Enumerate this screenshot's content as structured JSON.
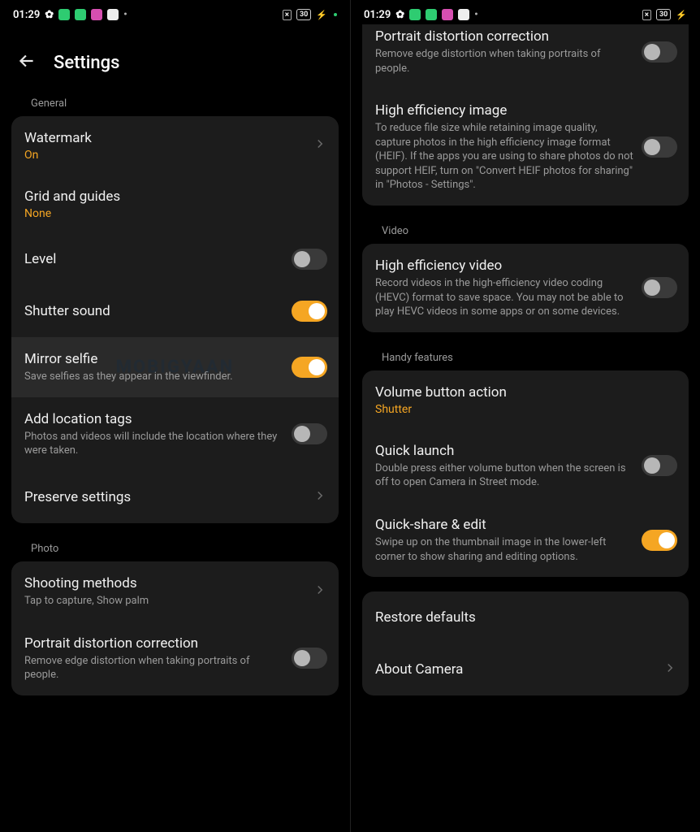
{
  "statusbar": {
    "time": "01:29",
    "battery": "30"
  },
  "header": {
    "title": "Settings"
  },
  "left": {
    "section_general": "General",
    "watermark": {
      "title": "Watermark",
      "value": "On"
    },
    "grid": {
      "title": "Grid and guides",
      "value": "None"
    },
    "level": {
      "title": "Level"
    },
    "shutter": {
      "title": "Shutter sound"
    },
    "mirror": {
      "title": "Mirror selfie",
      "sub": "Save selfies as they appear in the viewfinder."
    },
    "location": {
      "title": "Add location tags",
      "sub": "Photos and videos will include the location where they were taken."
    },
    "preserve": {
      "title": "Preserve settings"
    },
    "section_photo": "Photo",
    "shooting": {
      "title": "Shooting methods",
      "sub": "Tap to capture, Show palm"
    },
    "portrait": {
      "title": "Portrait distortion correction",
      "sub": "Remove edge distortion when taking portraits of people."
    }
  },
  "right": {
    "portrait": {
      "title": "Portrait distortion correction",
      "sub": "Remove edge distortion when taking portraits of people."
    },
    "heif": {
      "title": "High efficiency image",
      "sub": "To reduce file size while retaining image quality, capture photos in the high efficiency image format (HEIF). If the apps you are using to share photos do not support HEIF, turn on \"Convert HEIF photos for sharing\" in \"Photos - Settings\"."
    },
    "section_video": "Video",
    "hevc": {
      "title": "High efficiency video",
      "sub": "Record videos in the high-efficiency video coding (HEVC) format to save space. You may not be able to play HEVC videos in some apps or on some devices."
    },
    "section_handy": "Handy features",
    "volbtn": {
      "title": "Volume button action",
      "value": "Shutter"
    },
    "quicklaunch": {
      "title": "Quick launch",
      "sub": "Double press either volume button when the screen is off to open Camera in Street mode."
    },
    "quickshare": {
      "title": "Quick-share & edit",
      "sub": "Swipe up on the thumbnail image in the lower-left corner to show sharing and editing options."
    },
    "restore": {
      "title": "Restore defaults"
    },
    "about": {
      "title": "About Camera"
    }
  },
  "watermark_text": "MOBIGYAAN"
}
